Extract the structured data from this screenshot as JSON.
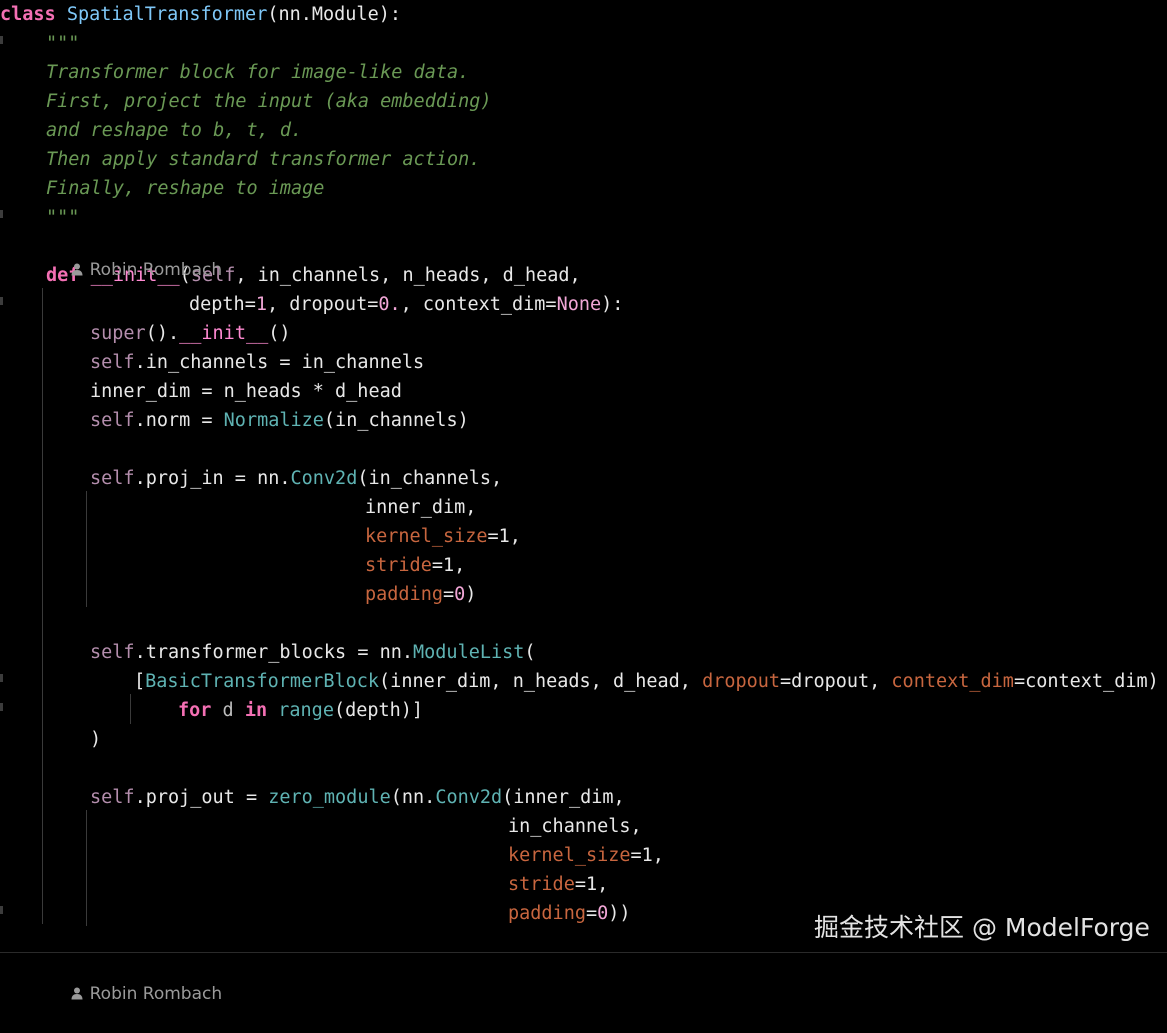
{
  "editor": {
    "author_lens": "Robin Rombach",
    "lines": [
      [
        [
          "class",
          "kw"
        ],
        [
          " ",
          "pu"
        ],
        [
          "SpatialTransformer",
          "cls"
        ],
        [
          "(nn.Module):",
          "pu"
        ]
      ],
      [
        [
          "\"\"\"",
          "doc"
        ]
      ],
      [
        [
          "Transformer block for image-like data.",
          "doc"
        ]
      ],
      [
        [
          "First, project the input (aka embedding)",
          "doc"
        ]
      ],
      [
        [
          "and reshape to b, t, d.",
          "doc"
        ]
      ],
      [
        [
          "Then apply standard transformer action.",
          "doc"
        ]
      ],
      [
        [
          "Finally, reshape to image",
          "doc"
        ]
      ],
      [
        [
          "\"\"\"",
          "doc"
        ]
      ],
      [
        [
          "def",
          "kw"
        ],
        [
          " ",
          "pu"
        ],
        [
          "__init__",
          "fn"
        ],
        [
          "(",
          "pu"
        ],
        [
          "self",
          "self"
        ],
        [
          ", in_channels, n_heads, d_head,",
          "id"
        ]
      ],
      [
        [
          "depth=",
          "id"
        ],
        [
          "1",
          "num"
        ],
        [
          ", dropout=",
          "id"
        ],
        [
          "0.",
          "num"
        ],
        [
          ", context_dim=",
          "id"
        ],
        [
          "None",
          "num"
        ],
        [
          "):",
          "pu"
        ]
      ],
      [
        [
          "super",
          "self"
        ],
        [
          "().",
          "pu"
        ],
        [
          "__init__",
          "fn"
        ],
        [
          "()",
          "pu"
        ]
      ],
      [
        [
          "self",
          "self"
        ],
        [
          ".in_channels = in_channels",
          "id"
        ]
      ],
      [
        [
          "inner_dim = n_heads * d_head",
          "id"
        ]
      ],
      [
        [
          "self",
          "self"
        ],
        [
          ".norm = ",
          "id"
        ],
        [
          "Normalize",
          "call"
        ],
        [
          "(in_channels)",
          "id"
        ]
      ],
      [
        [
          "self",
          "self"
        ],
        [
          ".proj_in = nn.",
          "id"
        ],
        [
          "Conv2d",
          "call"
        ],
        [
          "(in_channels,",
          "id"
        ]
      ],
      [
        [
          "inner_dim,",
          "id"
        ]
      ],
      [
        [
          "kernel_size",
          "param"
        ],
        [
          "=1,",
          "id"
        ]
      ],
      [
        [
          "stride",
          "param"
        ],
        [
          "=1,",
          "id"
        ]
      ],
      [
        [
          "padding",
          "param"
        ],
        [
          "=",
          "id"
        ],
        [
          "0",
          "num"
        ],
        [
          ")",
          "id"
        ]
      ],
      [
        [
          "self",
          "self"
        ],
        [
          ".transformer_blocks = nn.",
          "id"
        ],
        [
          "ModuleList",
          "call"
        ],
        [
          "(",
          "id"
        ]
      ],
      [
        [
          "[",
          "id"
        ],
        [
          "BasicTransformerBlock",
          "call"
        ],
        [
          "(inner_dim, n_heads, d_head, ",
          "id"
        ],
        [
          "dropout",
          "param"
        ],
        [
          "=dropout, ",
          "id"
        ],
        [
          "context_dim",
          "param"
        ],
        [
          "=context_dim)",
          "id"
        ]
      ],
      [
        [
          "for",
          "kw"
        ],
        [
          " d ",
          "dim"
        ],
        [
          "in",
          "kw"
        ],
        [
          " ",
          "id"
        ],
        [
          "range",
          "call"
        ],
        [
          "(depth)]",
          "id"
        ]
      ],
      [
        [
          ")",
          "id"
        ]
      ],
      [
        [
          "self",
          "self"
        ],
        [
          ".proj_out = ",
          "id"
        ],
        [
          "zero_module",
          "call"
        ],
        [
          "(nn.",
          "id"
        ],
        [
          "Conv2d",
          "call"
        ],
        [
          "(inner_dim,",
          "id"
        ]
      ],
      [
        [
          "in_channels,",
          "id"
        ]
      ],
      [
        [
          "kernel_size",
          "param"
        ],
        [
          "=1,",
          "id"
        ]
      ],
      [
        [
          "stride",
          "param"
        ],
        [
          "=1,",
          "id"
        ]
      ],
      [
        [
          "padding",
          "param"
        ],
        [
          "=",
          "id"
        ],
        [
          "0",
          "num"
        ],
        [
          "))",
          "id"
        ]
      ]
    ],
    "bottom_lens": "Robin Rombach"
  },
  "watermark": "掘金技术社区 @ ModelForge",
  "colors": {
    "background": "#000000",
    "keyword": "#f470b4",
    "class_name": "#7fc8f8",
    "docstring": "#6a9955",
    "parameter": "#c8663f",
    "call": "#5fb3b3",
    "self": "#b48ead"
  },
  "icons": {
    "codelens": "person-icon"
  }
}
